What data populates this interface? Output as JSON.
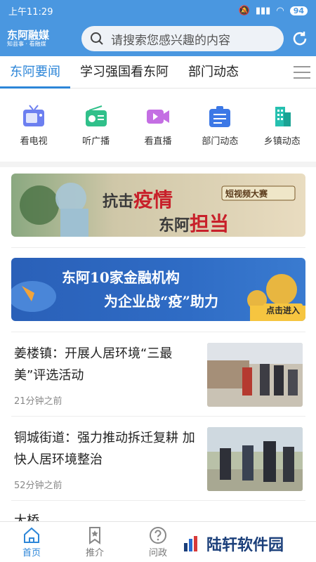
{
  "status": {
    "time": "上午11:29",
    "battery": "94"
  },
  "header": {
    "logo_title": "东阿融媒",
    "logo_sub": "知县事 · 看融媒",
    "search_placeholder": "请搜索您感兴趣的内容"
  },
  "tabs": [
    "东阿要闻",
    "学习强国看东阿",
    "部门动态"
  ],
  "quick": [
    "看电视",
    "听广播",
    "看直播",
    "部门动态",
    "乡镇动态"
  ],
  "banner1": {
    "a": "抗击",
    "b": "疫情",
    "c": "东阿",
    "d": "担当",
    "tag": "短视频大赛"
  },
  "banner2": {
    "line1": "东阿10家金融机构",
    "line2": "为企业战“疫”助力",
    "cta": "点击进入"
  },
  "news": [
    {
      "title": "姜楼镇：开展人居环境“三最美”评选活动",
      "time": "21分钟之前"
    },
    {
      "title": "铜城街道：强力推动拆迁复耕 加快人居环境整治",
      "time": "52分钟之前"
    },
    {
      "title": "大桥"
    }
  ],
  "nav": [
    "首页",
    "推介",
    "问政"
  ],
  "watermark": "陆轩软件园",
  "colors": {
    "accent": "#4a97e0",
    "active": "#2d86d8"
  }
}
